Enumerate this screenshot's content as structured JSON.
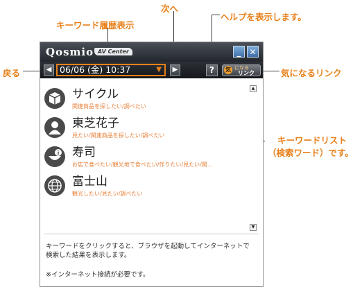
{
  "callouts": {
    "next": "次へ",
    "help": "ヘルプを表示します。",
    "history": "キーワード履歴表示",
    "back": "戻る",
    "fav": "気になるリンク",
    "list_1": "キーワードリスト",
    "list_2": "（検索ワード）です。"
  },
  "window": {
    "brand": "Qosmio",
    "brand_sub": "AV Center",
    "minimize_glyph": "_",
    "close_glyph": "✕"
  },
  "toolbar": {
    "back_glyph": "◀",
    "next_glyph": "▶",
    "history_value": "06/06 (金) 10:37",
    "dropdown_glyph": "▼",
    "help_glyph": "?",
    "fav_icon": "気",
    "fav_line1": "になる",
    "fav_line2": "リンク"
  },
  "keywords": [
    {
      "word": "サイクル",
      "sub": "関連商品を探したい/調べたい",
      "icon": "cube-icon"
    },
    {
      "word": "東芝花子",
      "sub": "見たい/関連商品を探したい/調べたい",
      "icon": "person-icon"
    },
    {
      "word": "寿司",
      "sub": "お店で食べたい/観光地で食べたい/作りたい/見たい/関...",
      "icon": "info-bowl-icon"
    },
    {
      "word": "富士山",
      "sub": "観光したい/見たい/調べたい",
      "icon": "globe-icon"
    }
  ],
  "scroll": {
    "up": "▲",
    "down": "▼"
  },
  "footer": {
    "line1": "キーワードをクリックすると、ブラウザを起動してインターネットで",
    "line2": "検索した結果を表示します。",
    "line3": "※インターネット接続が必要です。"
  },
  "colors": {
    "accent": "#e8801a",
    "title_bg": "#23272d",
    "button_blue": "#3d6fa8"
  }
}
